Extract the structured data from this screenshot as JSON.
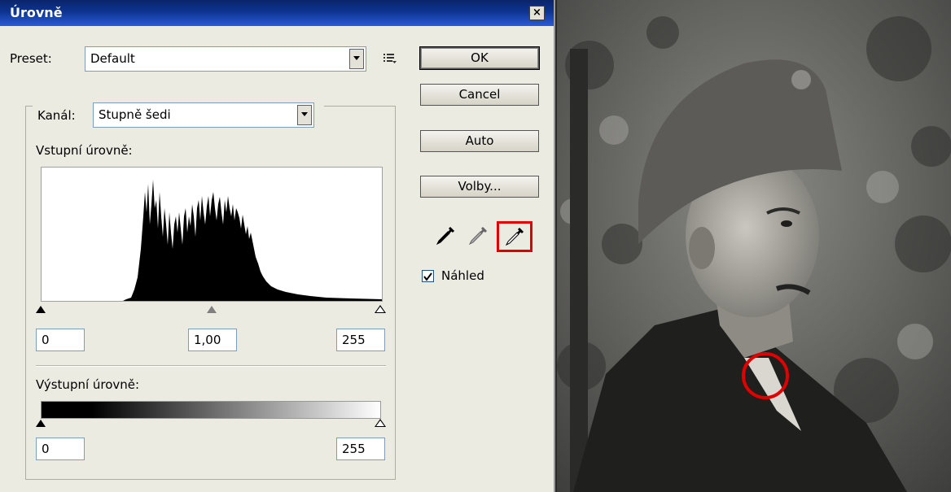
{
  "dialog": {
    "title": "Úrovně",
    "close_glyph": "×",
    "preset_label": "Preset:",
    "preset_value": "Default",
    "channel_label": "Kanál:",
    "channel_value": "Stupně šedi",
    "input_levels_label": "Vstupní úrovně:",
    "output_levels_label": "Výstupní úrovně:",
    "input_black": "0",
    "input_gamma": "1,00",
    "input_white": "255",
    "output_black": "0",
    "output_white": "255",
    "buttons": {
      "ok": "OK",
      "cancel": "Cancel",
      "auto": "Auto",
      "options": "Volby..."
    },
    "preview_label": "Náhled",
    "preview_checked": true,
    "icons": [
      "preset-menu-icon",
      "black-eyedropper-icon",
      "gray-eyedropper-icon",
      "white-eyedropper-icon"
    ]
  },
  "colors": {
    "title_bar": "#0d3490",
    "highlight": "#e00000",
    "dialog_bg": "#ecebe2"
  }
}
